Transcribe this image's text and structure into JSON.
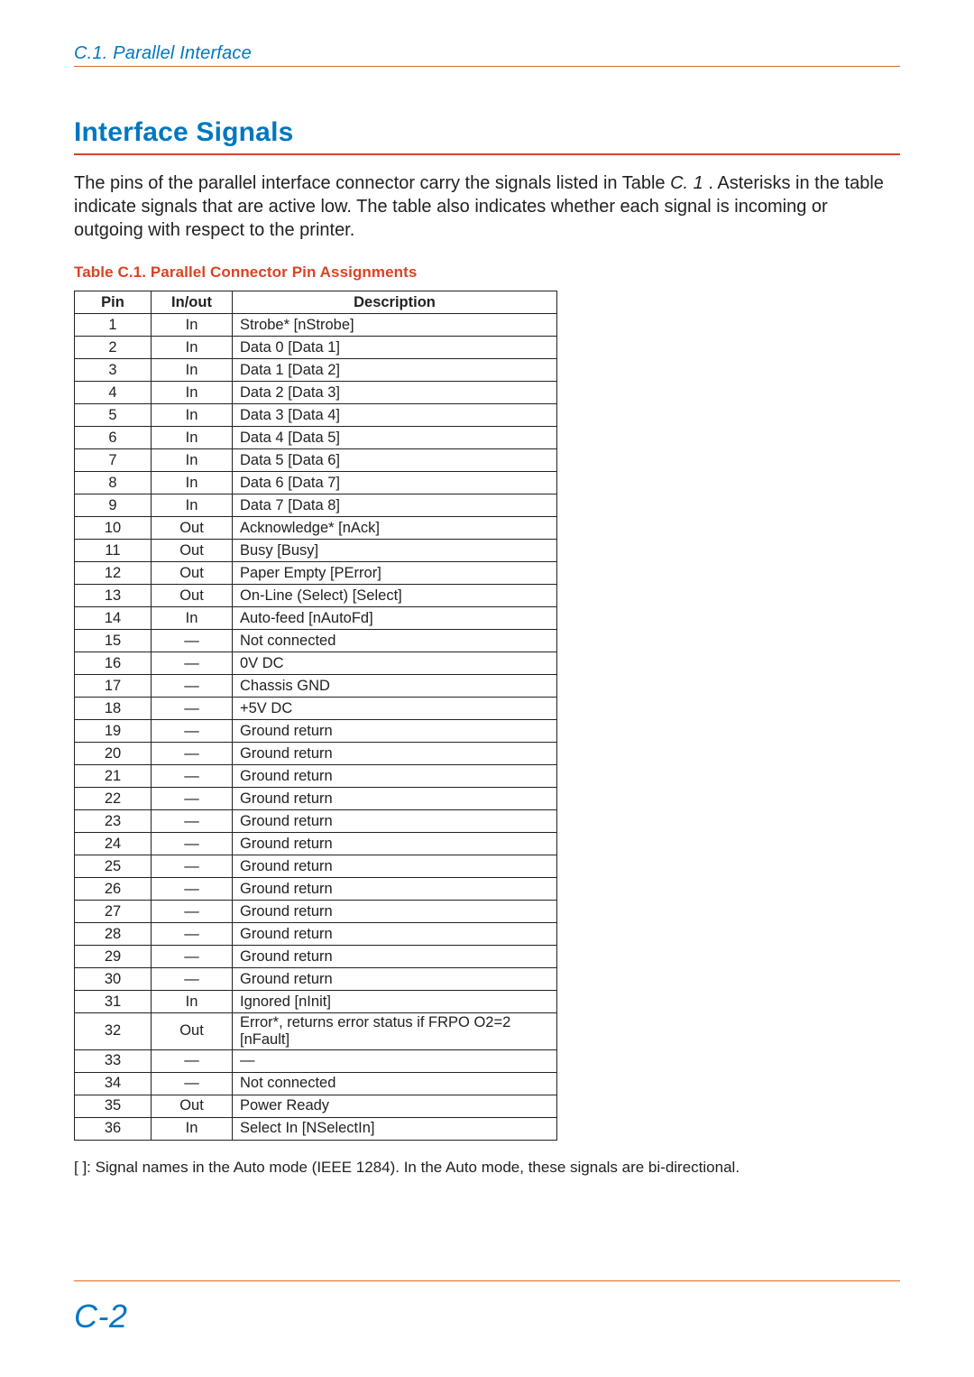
{
  "header": {
    "running_head": "C.1.  Parallel Interface"
  },
  "section": {
    "title": "Interface Signals",
    "intro_pre": "The pins of the parallel interface connector carry the signals listed in Table ",
    "intro_ref": "C. 1",
    "intro_post": " . Asterisks in the table indicate signals that are active low. The table also indicates whether each signal is incoming or outgoing with respect to the printer."
  },
  "table": {
    "caption": "Table C.1.  Parallel Connector Pin Assignments",
    "headers": {
      "pin": "Pin",
      "inout": "In/out",
      "description": "Description"
    },
    "rows": [
      {
        "pin": "1",
        "inout": "In",
        "desc": "Strobe* [nStrobe]"
      },
      {
        "pin": "2",
        "inout": "In",
        "desc": "Data 0 [Data 1]"
      },
      {
        "pin": "3",
        "inout": "In",
        "desc": "Data 1 [Data 2]"
      },
      {
        "pin": "4",
        "inout": "In",
        "desc": "Data 2 [Data 3]"
      },
      {
        "pin": "5",
        "inout": "In",
        "desc": "Data 3 [Data 4]"
      },
      {
        "pin": "6",
        "inout": "In",
        "desc": "Data 4 [Data 5]"
      },
      {
        "pin": "7",
        "inout": "In",
        "desc": "Data 5 [Data 6]"
      },
      {
        "pin": "8",
        "inout": "In",
        "desc": "Data 6 [Data 7]"
      },
      {
        "pin": "9",
        "inout": "In",
        "desc": "Data 7 [Data 8]"
      },
      {
        "pin": "10",
        "inout": "Out",
        "desc": "Acknowledge* [nAck]"
      },
      {
        "pin": "11",
        "inout": "Out",
        "desc": "Busy [Busy]"
      },
      {
        "pin": "12",
        "inout": "Out",
        "desc": "Paper Empty [PError]"
      },
      {
        "pin": "13",
        "inout": "Out",
        "desc": "On-Line (Select) [Select]"
      },
      {
        "pin": "14",
        "inout": "In",
        "desc": "Auto-feed [nAutoFd]"
      },
      {
        "pin": "15",
        "inout": "—",
        "desc": "Not connected"
      },
      {
        "pin": "16",
        "inout": "—",
        "desc": "0V DC"
      },
      {
        "pin": "17",
        "inout": "—",
        "desc": "Chassis GND"
      },
      {
        "pin": "18",
        "inout": "—",
        "desc": "+5V DC"
      },
      {
        "pin": "19",
        "inout": "—",
        "desc": "Ground return"
      },
      {
        "pin": "20",
        "inout": "—",
        "desc": "Ground return"
      },
      {
        "pin": "21",
        "inout": "—",
        "desc": "Ground return"
      },
      {
        "pin": "22",
        "inout": "—",
        "desc": "Ground return"
      },
      {
        "pin": "23",
        "inout": "—",
        "desc": "Ground return"
      },
      {
        "pin": "24",
        "inout": "—",
        "desc": "Ground return"
      },
      {
        "pin": "25",
        "inout": "—",
        "desc": "Ground return"
      },
      {
        "pin": "26",
        "inout": "—",
        "desc": "Ground return"
      },
      {
        "pin": "27",
        "inout": "—",
        "desc": "Ground return"
      },
      {
        "pin": "28",
        "inout": "—",
        "desc": "Ground return"
      },
      {
        "pin": "29",
        "inout": "—",
        "desc": "Ground return"
      },
      {
        "pin": "30",
        "inout": "—",
        "desc": "Ground return"
      },
      {
        "pin": "31",
        "inout": "In",
        "desc": "Ignored [nInit]"
      },
      {
        "pin": "32",
        "inout": "Out",
        "desc": "Error*, returns error status if FRPO O2=2 [nFault]"
      },
      {
        "pin": "33",
        "inout": "—",
        "desc": "—"
      },
      {
        "pin": "34",
        "inout": "—",
        "desc": "Not connected"
      },
      {
        "pin": "35",
        "inout": "Out",
        "desc": "Power Ready"
      },
      {
        "pin": "36",
        "inout": "In",
        "desc": "Select In [NSelectIn]"
      }
    ]
  },
  "footnote": "[    ]: Signal names in the Auto mode (IEEE 1284).  In the Auto mode, these signals are bi-directional.",
  "page_number": "C-2"
}
